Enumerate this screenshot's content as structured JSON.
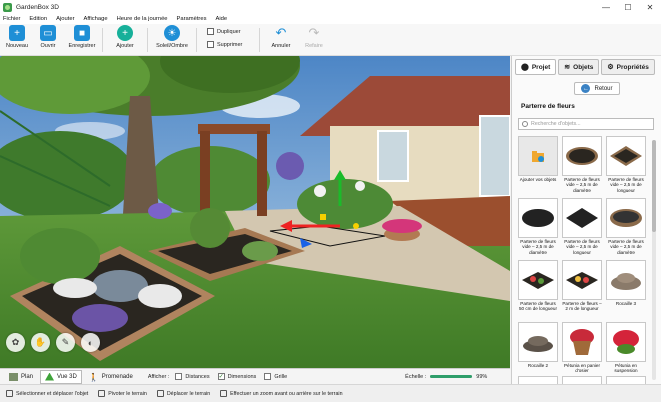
{
  "window": {
    "title": "GardenBox 3D",
    "minimize": "—",
    "maximize": "☐",
    "close": "✕"
  },
  "menu": [
    "Fichier",
    "Edition",
    "Ajouter",
    "Affichage",
    "Heure de la journée",
    "Paramètres",
    "Aide"
  ],
  "toolbar": {
    "new": "Nouveau",
    "open": "Ouvrir",
    "save": "Enregistrer",
    "add": "Ajouter",
    "sun": "Soleil/Ombre",
    "duplicate": "Dupliquer",
    "delete": "Supprimer",
    "undo": "Annuler",
    "redo": "Refaire"
  },
  "viewbar": {
    "plan": "Plan",
    "view3d": "Vue 3D",
    "walk": "Promenade",
    "show": "Afficher :",
    "distances": "Distances",
    "dimensions": "Dimensions",
    "grid": "Grille",
    "scale_label": "Échelle :",
    "scale_value": "99%",
    "scale_fraction": 0.99
  },
  "status": [
    "Sélectionner et déplacer l'objet",
    "Pivoter le terrain",
    "Déplacer le terrain",
    "Effectuer un zoom avant ou arrière sur le terrain"
  ],
  "panel": {
    "tabs": [
      "Projet",
      "Objets",
      "Propriétés"
    ],
    "back": "Retour",
    "section_title": "Parterre de fleurs",
    "search_placeholder": "Recherche d'objets...",
    "items": [
      "Ajouter vos objets",
      "Parterre de fleurs vide – 2,5 m de diamètre",
      "Parterre de fleurs vide – 2,5 m de longueur",
      "Parterre de fleurs vide – 2,5 m de diamètre",
      "Parterre de fleurs vide – 2,5 m de longueur",
      "Parterre de fleurs vide – 2,5 m de diamètre",
      "Parterre de fleurs 50 cm de longueur",
      "Parterre de fleurs – 2 m de longueur",
      "Rocaille 3",
      "Rocaille 2",
      "Pétunia en panier d'osier",
      "Pétunia en suspension",
      "",
      "",
      ""
    ]
  }
}
